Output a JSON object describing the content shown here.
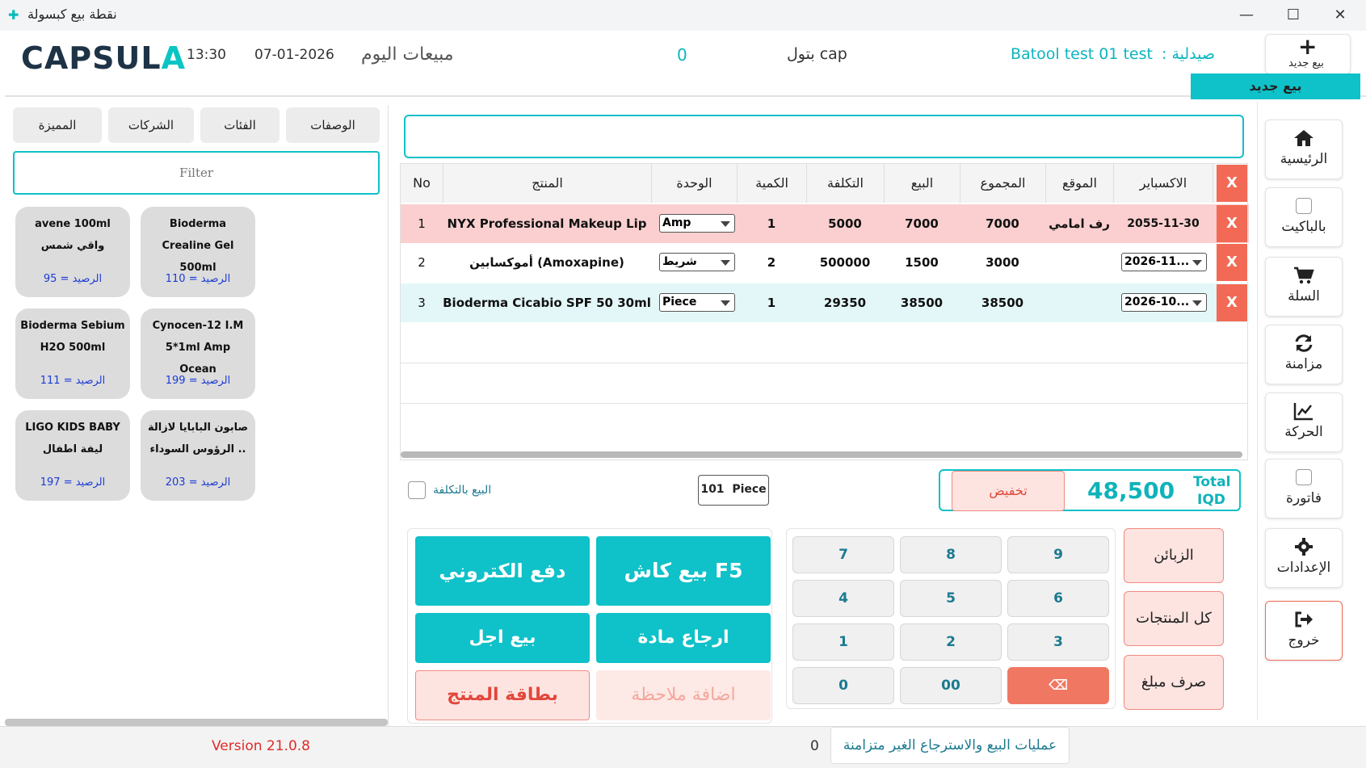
{
  "window": {
    "title": "نقطة بيع كبسولة",
    "minimize": "—",
    "maximize": "☐",
    "close": "✕"
  },
  "header": {
    "brand_main": "CAPSUL",
    "brand_accent": "A",
    "time": "13:30",
    "date": "07-01-2026",
    "today_sales_label": "مبيعات اليوم",
    "today_sales_value": "0",
    "user": "بتول cap",
    "pharmacy_name": "Batool test 01 test",
    "pharmacy_label": "صيدلية :",
    "new_sale_plus": "+",
    "new_sale_label": "بيع جديد",
    "new_sale_tab": "بيع جديد"
  },
  "nav": [
    {
      "label": "الرئيسية",
      "icon": "home-icon",
      "glyph": "⌂"
    },
    {
      "label": "بالباكيت",
      "icon": "checkbox",
      "glyph": ""
    },
    {
      "label": "السلة",
      "icon": "cart-icon",
      "glyph": "🛒"
    },
    {
      "label": "مزامنة",
      "icon": "sync-icon",
      "glyph": "⟳"
    },
    {
      "label": "الحركة",
      "icon": "chart-icon",
      "glyph": "📈"
    },
    {
      "label": "فاتورة",
      "icon": "checkbox",
      "glyph": ""
    },
    {
      "label": "الإعدادات",
      "icon": "gear-icon",
      "glyph": "⚙"
    },
    {
      "label": "خروج",
      "icon": "logout-icon",
      "glyph": "⇥"
    }
  ],
  "left_tabs": [
    "الوصفات",
    "الفئات",
    "الشركات",
    "المميزة"
  ],
  "filter_placeholder": "Filter",
  "products": [
    {
      "name": "Bioderma Crealine Gel 500ml",
      "balance": "الرصيد = 110"
    },
    {
      "name": "avene 100ml  واقي شمس",
      "balance": "الرصيد = 95"
    },
    {
      "name": "Cynocen-12 I.M 5*1ml Amp Ocean",
      "balance": "الرصيد = 199"
    },
    {
      "name": "Bioderma Sebium H2O 500ml",
      "balance": "الرصيد = 111"
    },
    {
      "name": "صابون البابايا لازالة الرؤوس السوداء ..",
      "balance": "الرصيد = 203"
    },
    {
      "name": "LIGO KIDS BABY ليفة اطفال",
      "balance": "الرصيد = 197"
    }
  ],
  "table": {
    "headers": {
      "no": "No",
      "product": "المنتج",
      "unit": "الوحدة",
      "qty": "الكمية",
      "cost": "التكلفة",
      "price": "البيع",
      "total": "المجموع",
      "location": "الموقع",
      "expiry": "الاكسباير",
      "x": "X"
    },
    "rows": [
      {
        "no": "1",
        "product": "NYX Professional Makeup Lip I...",
        "unit": "Amp",
        "qty": "1",
        "cost": "5000",
        "price": "7000",
        "total": "7000",
        "location": "رف امامي",
        "expiry": "2055-11-30",
        "x": "X"
      },
      {
        "no": "2",
        "product": "أموكسابين (Amoxapine)",
        "unit": "شريط",
        "qty": "2",
        "cost": "500000",
        "price": "1500",
        "total": "3000",
        "location": "",
        "expiry": "2026-11...",
        "x": "X"
      },
      {
        "no": "3",
        "product": "Bioderma Cicabio SPF 50 30ml",
        "unit": "Piece",
        "qty": "1",
        "cost": "29350",
        "price": "38500",
        "total": "38500",
        "location": "",
        "expiry": "2026-10...",
        "x": "X"
      }
    ]
  },
  "cost_sale_label": "البيع بالتكلفة",
  "stock_indicator": {
    "qty": "101",
    "unit": "Piece"
  },
  "discount_label": "تخفيض",
  "total": {
    "value": "48,500",
    "label": "Total",
    "currency": "IQD"
  },
  "actions": {
    "cash_sale": "بيع كاش F5",
    "e_payment": "دفع الكتروني",
    "return_item": "ارجاع مادة",
    "credit_sale": "بيع اجل",
    "add_note": "اضافة ملاحظة",
    "product_card": "بطاقة المنتج"
  },
  "keypad": [
    "7",
    "8",
    "9",
    "4",
    "5",
    "6",
    "1",
    "2",
    "3",
    "0",
    "00",
    "⌫"
  ],
  "side_actions": {
    "customers": "الزبائن",
    "all_products": "كل المنتجات",
    "pay_amount": "صرف مبلغ"
  },
  "footer": {
    "version": "Version 21.0.8",
    "unsynced_count": "0",
    "unsynced_label": "عمليات البيع والاسترجاع الغير متزامنة"
  },
  "colors": {
    "teal": "#0fc1c8",
    "red": "#f26a55",
    "pink": "#fde4e1",
    "row_pink": "#fbcfcf",
    "row_teal": "#e3f7f8"
  }
}
